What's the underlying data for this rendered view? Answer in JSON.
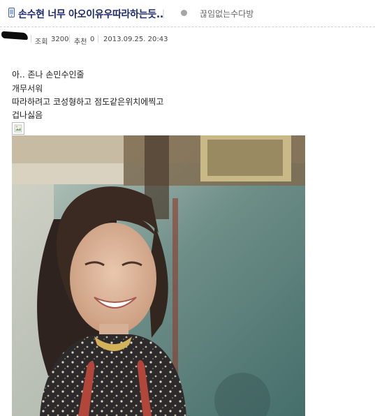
{
  "header": {
    "title": "손수현 너무 아오이유우따라하는듯..",
    "gallery": "끊임없는수다방",
    "icons": {
      "device": "mobile-phone-icon",
      "gallery_marker": "gray-dot-icon"
    }
  },
  "meta": {
    "views_label": "조회",
    "views_value": "3200",
    "recommend_label": "추천",
    "recommend_value": "0",
    "datetime": "2013.09.25. 20:43"
  },
  "post": {
    "lines": [
      "아.. 존나 손민수인줄",
      "개무서워",
      "따라하려고 코성형하고 점도같은위치에찍고",
      "겁나싫음"
    ],
    "broken_image_icon": "broken-image-icon",
    "photo": "smiling-woman-photo"
  },
  "colors": {
    "title": "#1e2a6e",
    "meta_text": "#444444",
    "divider": "#cfcfcf"
  }
}
